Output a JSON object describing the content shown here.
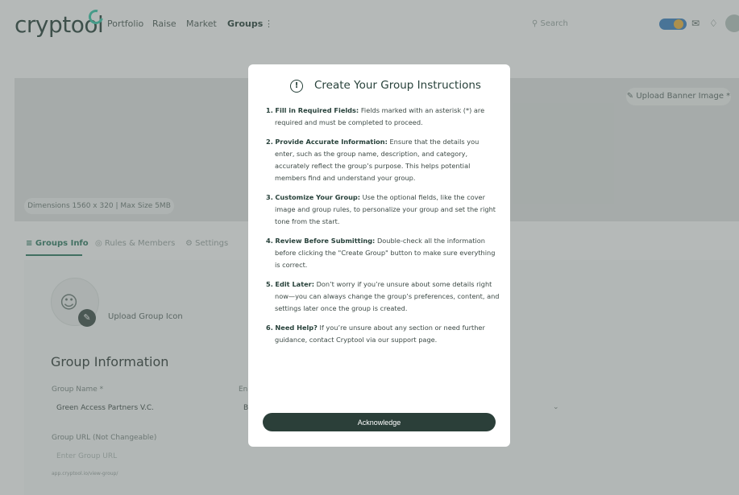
{
  "app": {
    "logo": "cryptool"
  },
  "nav": {
    "items": [
      "Portfolio",
      "Raise",
      "Market",
      "Groups"
    ],
    "active": "Groups",
    "more_icon": "more-vertical-icon"
  },
  "search": {
    "placeholder": "Search"
  },
  "banner": {
    "upload_label": "Upload Banner Image *",
    "dimensions": "Dimensions 1560 x 320 | Max Size 5MB"
  },
  "tabs": {
    "items": [
      "Groups Info",
      "Rules & Members",
      "Settings"
    ],
    "active": "Groups Info"
  },
  "group_icon": {
    "upload_label": "Upload Group Icon"
  },
  "form": {
    "section_title": "Group Information",
    "group_name_label": "Group Name *",
    "group_name_value": "Green Access Partners V.C.",
    "second_label": "En",
    "second_value": "B",
    "url_label": "Group URL (Not Changeable)",
    "url_placeholder": "Enter Group URL",
    "url_hint": "app.cryptool.io/view-group/"
  },
  "modal": {
    "title": "Create Your Group Instructions",
    "steps": [
      {
        "num": "1.",
        "head": "Fill in Required Fields:",
        "text": "Fields marked with an asterisk (*) are required and must be completed to proceed."
      },
      {
        "num": "2.",
        "head": "Provide Accurate Information:",
        "text": "Ensure that the details you enter, such as the group name, description, and category, accurately reflect the group’s purpose. This helps potential members find and understand your group."
      },
      {
        "num": "3.",
        "head": "Customize Your Group:",
        "text": "Use the optional fields, like the cover image and group rules, to personalize your group and set the right tone from the start."
      },
      {
        "num": "4.",
        "head": "Review Before Submitting:",
        "text": "Double-check all the information before clicking the \"Create Group\" button to make sure everything is correct."
      },
      {
        "num": "5.",
        "head": "Edit Later:",
        "text": "Don’t worry if you’re unsure about some details right now—you can always change the group’s preferences, content, and settings later once the group is created."
      },
      {
        "num": "6.",
        "head": "Need Help?",
        "text": "If you’re unsure about any section or need further guidance, contact Cryptool via our support page."
      }
    ],
    "acknowledge_label": "Acknowledge"
  },
  "colors": {
    "brand": "#27413a",
    "accent": "#36c9a9",
    "button": "#2b3f39"
  }
}
